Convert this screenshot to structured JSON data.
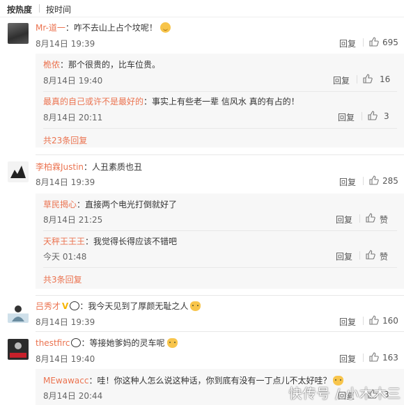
{
  "sort": {
    "hot": "按热度",
    "time": "按时间"
  },
  "c1": {
    "user": "Mr-道一",
    "text": "：咋不去山上占个坟呢！",
    "date": "8月14日 19:39",
    "reply": "回复",
    "likes": "695"
  },
  "c1r1": {
    "user": "桅侬",
    "text": "：那个很贵的，比车位贵。",
    "date": "8月14日 19:40",
    "reply": "回复",
    "likes": "16"
  },
  "c1r2": {
    "user": "最真的自己或许不是最好的",
    "text": "：事实上有些老一辈 信风水 真的有占的！",
    "date": "8月14日 20:11",
    "reply": "回复",
    "likes": "3"
  },
  "c1more": "共23条回复",
  "c2": {
    "user": "李柏霖Justin",
    "text": "：人丑素质也丑",
    "date": "8月14日 19:39",
    "reply": "回复",
    "likes": "285"
  },
  "c2r1": {
    "user": "草民揭心",
    "text": "：直接两个电光打倒就好了",
    "date": "8月14日 21:25",
    "reply": "回复",
    "likes": "赞"
  },
  "c2r2": {
    "user": "天秤王王王",
    "text": "：我觉得长得应该不错吧",
    "date": "今天 01:48",
    "reply": "回复",
    "likes": "赞"
  },
  "c2more": "共3条回复",
  "c3": {
    "user": "吕秀才",
    "badge": "V",
    "text": "：我今天见到了厚颜无耻之人",
    "date": "8月14日 19:39",
    "reply": "回复",
    "likes": "160"
  },
  "c4": {
    "user": "thestfirc",
    "text": "：等接她爹妈的灵车呢",
    "date": "8月14日 19:40",
    "reply": "回复",
    "likes": "163"
  },
  "c4r1": {
    "user": "MEwawacc",
    "text": "：哇！你这种人怎么说这种话，你到底有没有一丁点儿不太好哇？",
    "date": "8月14日 20:44",
    "reply": "回复",
    "likes": "3"
  },
  "watermark": "快传号 / 小木木三"
}
